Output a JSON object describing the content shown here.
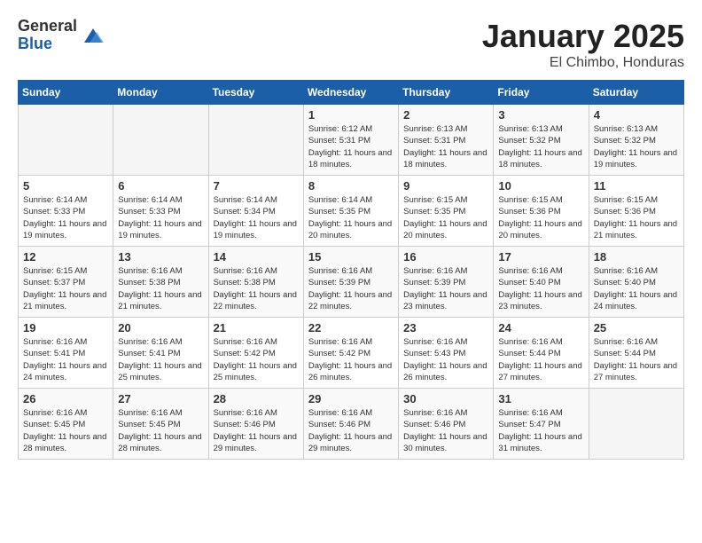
{
  "logo": {
    "general": "General",
    "blue": "Blue"
  },
  "header": {
    "month": "January 2025",
    "location": "El Chimbo, Honduras"
  },
  "weekdays": [
    "Sunday",
    "Monday",
    "Tuesday",
    "Wednesday",
    "Thursday",
    "Friday",
    "Saturday"
  ],
  "weeks": [
    [
      {
        "day": "",
        "sunrise": "",
        "sunset": "",
        "daylight": ""
      },
      {
        "day": "",
        "sunrise": "",
        "sunset": "",
        "daylight": ""
      },
      {
        "day": "",
        "sunrise": "",
        "sunset": "",
        "daylight": ""
      },
      {
        "day": "1",
        "sunrise": "Sunrise: 6:12 AM",
        "sunset": "Sunset: 5:31 PM",
        "daylight": "Daylight: 11 hours and 18 minutes."
      },
      {
        "day": "2",
        "sunrise": "Sunrise: 6:13 AM",
        "sunset": "Sunset: 5:31 PM",
        "daylight": "Daylight: 11 hours and 18 minutes."
      },
      {
        "day": "3",
        "sunrise": "Sunrise: 6:13 AM",
        "sunset": "Sunset: 5:32 PM",
        "daylight": "Daylight: 11 hours and 18 minutes."
      },
      {
        "day": "4",
        "sunrise": "Sunrise: 6:13 AM",
        "sunset": "Sunset: 5:32 PM",
        "daylight": "Daylight: 11 hours and 19 minutes."
      }
    ],
    [
      {
        "day": "5",
        "sunrise": "Sunrise: 6:14 AM",
        "sunset": "Sunset: 5:33 PM",
        "daylight": "Daylight: 11 hours and 19 minutes."
      },
      {
        "day": "6",
        "sunrise": "Sunrise: 6:14 AM",
        "sunset": "Sunset: 5:33 PM",
        "daylight": "Daylight: 11 hours and 19 minutes."
      },
      {
        "day": "7",
        "sunrise": "Sunrise: 6:14 AM",
        "sunset": "Sunset: 5:34 PM",
        "daylight": "Daylight: 11 hours and 19 minutes."
      },
      {
        "day": "8",
        "sunrise": "Sunrise: 6:14 AM",
        "sunset": "Sunset: 5:35 PM",
        "daylight": "Daylight: 11 hours and 20 minutes."
      },
      {
        "day": "9",
        "sunrise": "Sunrise: 6:15 AM",
        "sunset": "Sunset: 5:35 PM",
        "daylight": "Daylight: 11 hours and 20 minutes."
      },
      {
        "day": "10",
        "sunrise": "Sunrise: 6:15 AM",
        "sunset": "Sunset: 5:36 PM",
        "daylight": "Daylight: 11 hours and 20 minutes."
      },
      {
        "day": "11",
        "sunrise": "Sunrise: 6:15 AM",
        "sunset": "Sunset: 5:36 PM",
        "daylight": "Daylight: 11 hours and 21 minutes."
      }
    ],
    [
      {
        "day": "12",
        "sunrise": "Sunrise: 6:15 AM",
        "sunset": "Sunset: 5:37 PM",
        "daylight": "Daylight: 11 hours and 21 minutes."
      },
      {
        "day": "13",
        "sunrise": "Sunrise: 6:16 AM",
        "sunset": "Sunset: 5:38 PM",
        "daylight": "Daylight: 11 hours and 21 minutes."
      },
      {
        "day": "14",
        "sunrise": "Sunrise: 6:16 AM",
        "sunset": "Sunset: 5:38 PM",
        "daylight": "Daylight: 11 hours and 22 minutes."
      },
      {
        "day": "15",
        "sunrise": "Sunrise: 6:16 AM",
        "sunset": "Sunset: 5:39 PM",
        "daylight": "Daylight: 11 hours and 22 minutes."
      },
      {
        "day": "16",
        "sunrise": "Sunrise: 6:16 AM",
        "sunset": "Sunset: 5:39 PM",
        "daylight": "Daylight: 11 hours and 23 minutes."
      },
      {
        "day": "17",
        "sunrise": "Sunrise: 6:16 AM",
        "sunset": "Sunset: 5:40 PM",
        "daylight": "Daylight: 11 hours and 23 minutes."
      },
      {
        "day": "18",
        "sunrise": "Sunrise: 6:16 AM",
        "sunset": "Sunset: 5:40 PM",
        "daylight": "Daylight: 11 hours and 24 minutes."
      }
    ],
    [
      {
        "day": "19",
        "sunrise": "Sunrise: 6:16 AM",
        "sunset": "Sunset: 5:41 PM",
        "daylight": "Daylight: 11 hours and 24 minutes."
      },
      {
        "day": "20",
        "sunrise": "Sunrise: 6:16 AM",
        "sunset": "Sunset: 5:41 PM",
        "daylight": "Daylight: 11 hours and 25 minutes."
      },
      {
        "day": "21",
        "sunrise": "Sunrise: 6:16 AM",
        "sunset": "Sunset: 5:42 PM",
        "daylight": "Daylight: 11 hours and 25 minutes."
      },
      {
        "day": "22",
        "sunrise": "Sunrise: 6:16 AM",
        "sunset": "Sunset: 5:42 PM",
        "daylight": "Daylight: 11 hours and 26 minutes."
      },
      {
        "day": "23",
        "sunrise": "Sunrise: 6:16 AM",
        "sunset": "Sunset: 5:43 PM",
        "daylight": "Daylight: 11 hours and 26 minutes."
      },
      {
        "day": "24",
        "sunrise": "Sunrise: 6:16 AM",
        "sunset": "Sunset: 5:44 PM",
        "daylight": "Daylight: 11 hours and 27 minutes."
      },
      {
        "day": "25",
        "sunrise": "Sunrise: 6:16 AM",
        "sunset": "Sunset: 5:44 PM",
        "daylight": "Daylight: 11 hours and 27 minutes."
      }
    ],
    [
      {
        "day": "26",
        "sunrise": "Sunrise: 6:16 AM",
        "sunset": "Sunset: 5:45 PM",
        "daylight": "Daylight: 11 hours and 28 minutes."
      },
      {
        "day": "27",
        "sunrise": "Sunrise: 6:16 AM",
        "sunset": "Sunset: 5:45 PM",
        "daylight": "Daylight: 11 hours and 28 minutes."
      },
      {
        "day": "28",
        "sunrise": "Sunrise: 6:16 AM",
        "sunset": "Sunset: 5:46 PM",
        "daylight": "Daylight: 11 hours and 29 minutes."
      },
      {
        "day": "29",
        "sunrise": "Sunrise: 6:16 AM",
        "sunset": "Sunset: 5:46 PM",
        "daylight": "Daylight: 11 hours and 29 minutes."
      },
      {
        "day": "30",
        "sunrise": "Sunrise: 6:16 AM",
        "sunset": "Sunset: 5:46 PM",
        "daylight": "Daylight: 11 hours and 30 minutes."
      },
      {
        "day": "31",
        "sunrise": "Sunrise: 6:16 AM",
        "sunset": "Sunset: 5:47 PM",
        "daylight": "Daylight: 11 hours and 31 minutes."
      },
      {
        "day": "",
        "sunrise": "",
        "sunset": "",
        "daylight": ""
      }
    ]
  ]
}
